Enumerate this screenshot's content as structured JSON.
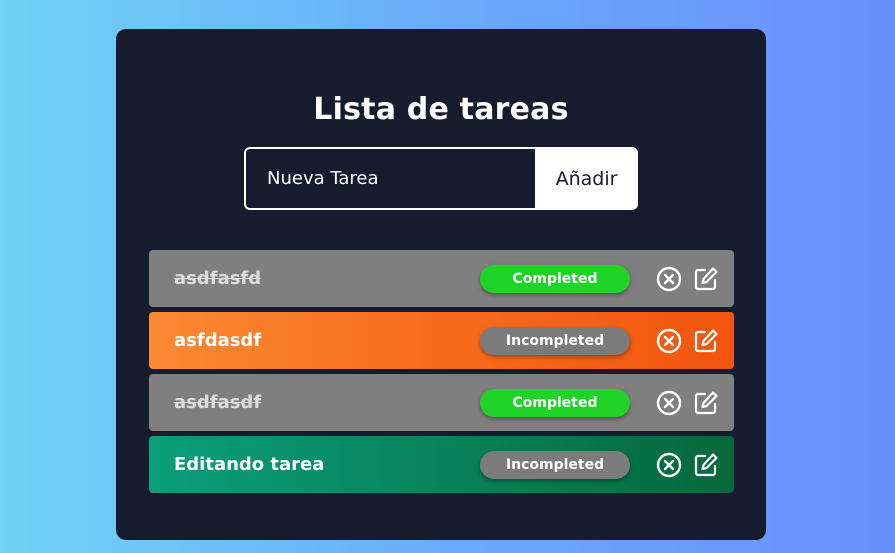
{
  "app": {
    "title": "Lista de tareas"
  },
  "form": {
    "input_placeholder": "Nueva Tarea",
    "add_label": "Añadir"
  },
  "tasks": [
    {
      "text": "asdfasfd",
      "status": "Completed",
      "completed": true
    },
    {
      "text": "asfdasdf",
      "status": "Incompleted",
      "completed": false
    },
    {
      "text": "asdfasdf",
      "status": "Completed",
      "completed": true
    },
    {
      "text": "Editando tarea",
      "status": "Incompleted",
      "completed": false
    }
  ],
  "icons": {
    "delete": "close-circle-icon",
    "edit": "edit-icon"
  },
  "colors": {
    "card_background": "#171b2e",
    "completed_row": "#7f7f7f",
    "completed_badge": "#20d327",
    "incompleted_badge": "#7b7b7b",
    "orange_row": "#f76b1c",
    "green_row": "#078058"
  }
}
